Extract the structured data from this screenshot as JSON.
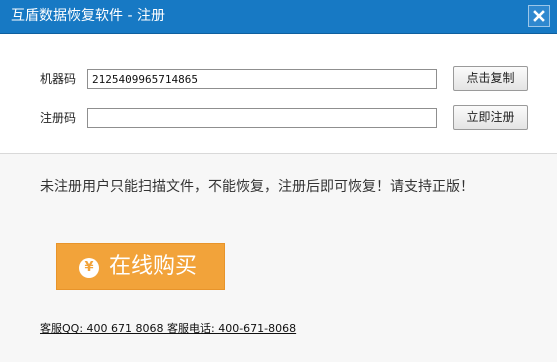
{
  "window": {
    "title": "互盾数据恢复软件 - 注册",
    "close_icon": "close-icon"
  },
  "form": {
    "machine_code_label": "机器码",
    "machine_code_value": "2125409965714865",
    "copy_button_label": "点击复制",
    "register_code_label": "注册码",
    "register_code_value": "",
    "register_button_label": "立即注册"
  },
  "notice": {
    "text": "未注册用户只能扫描文件，不能恢复，注册后即可恢复！请支持正版！"
  },
  "buy": {
    "icon": "yen-icon",
    "icon_glyph": "¥",
    "label": "在线购买"
  },
  "contact": {
    "text": "客服QQ: 400 671 8068 客服电话: 400-671-8068"
  },
  "colors": {
    "titlebar": "#1779c4",
    "buy_button": "#f2a33a",
    "lower_background": "#f7f7f7"
  }
}
